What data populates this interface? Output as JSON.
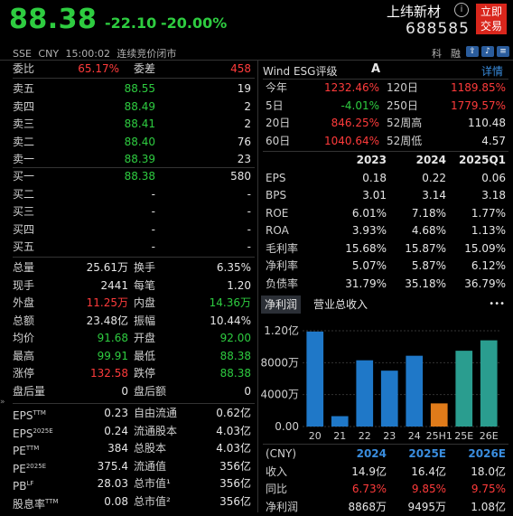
{
  "header": {
    "price": "88.38",
    "change": "-22.10",
    "change_pct": "-20.00%",
    "name": "上纬新材",
    "code": "688585",
    "info_icon": "i",
    "trade_button": [
      "立即",
      "交易"
    ],
    "sub": "SSE  CNY  15:00:02  连续竞价闭市",
    "right_tabs": [
      "科",
      "融"
    ]
  },
  "orderbook": {
    "wei_bi_label": "委比",
    "wei_bi": "65.17%",
    "wei_cha_label": "委差",
    "wei_cha": "458",
    "asks": [
      {
        "label": "卖五",
        "price": "88.55",
        "vol": "19"
      },
      {
        "label": "卖四",
        "price": "88.49",
        "vol": "2"
      },
      {
        "label": "卖三",
        "price": "88.41",
        "vol": "2"
      },
      {
        "label": "卖二",
        "price": "88.40",
        "vol": "76"
      },
      {
        "label": "卖一",
        "price": "88.39",
        "vol": "23"
      }
    ],
    "bids": [
      {
        "label": "买一",
        "price": "88.38",
        "vol": "580"
      },
      {
        "label": "买二",
        "price": "-",
        "vol": "-"
      },
      {
        "label": "买三",
        "price": "-",
        "vol": "-"
      },
      {
        "label": "买四",
        "price": "-",
        "vol": "-"
      },
      {
        "label": "买五",
        "price": "-",
        "vol": "-"
      }
    ]
  },
  "stats": [
    {
      "l1": "总量",
      "v1": "25.61万",
      "c1": "w",
      "l2": "换手",
      "v2": "6.35%",
      "c2": "w"
    },
    {
      "l1": "现手",
      "v1": "2441",
      "c1": "w",
      "l2": "每笔",
      "v2": "1.20",
      "c2": "w"
    },
    {
      "l1": "外盘",
      "v1": "11.25万",
      "c1": "r",
      "l2": "内盘",
      "v2": "14.36万",
      "c2": "g"
    },
    {
      "l1": "总额",
      "v1": "23.48亿",
      "c1": "w",
      "l2": "振幅",
      "v2": "10.44%",
      "c2": "w"
    },
    {
      "l1": "均价",
      "v1": "91.68",
      "c1": "g",
      "l2": "开盘",
      "v2": "92.00",
      "c2": "g"
    },
    {
      "l1": "最高",
      "v1": "99.91",
      "c1": "g",
      "l2": "最低",
      "v2": "88.38",
      "c2": "g"
    },
    {
      "l1": "涨停",
      "v1": "132.58",
      "c1": "r",
      "l2": "跌停",
      "v2": "88.38",
      "c2": "g"
    },
    {
      "l1": "盘后量",
      "v1": "0",
      "c1": "w",
      "l2": "盘后额",
      "v2": "0",
      "c2": "w"
    }
  ],
  "valuation": [
    {
      "l1": "EPS",
      "s1": "TTM",
      "v1": "0.23",
      "l2": "自由流通",
      "v2": "0.62亿"
    },
    {
      "l1": "EPS",
      "s1": "2025E",
      "v1": "0.24",
      "l2": "流通股本",
      "v2": "4.03亿"
    },
    {
      "l1": "PE",
      "s1": "TTM",
      "v1": "384",
      "l2": "总股本",
      "v2": "4.03亿"
    },
    {
      "l1": "PE",
      "s1": "2025E",
      "v1": "375.4",
      "l2": "流通值",
      "v2": "356亿"
    },
    {
      "l1": "PB",
      "s1": "LF",
      "v1": "28.03",
      "l2": "总市值¹",
      "v2": "356亿"
    },
    {
      "l1": "股息率",
      "s1": "TTM",
      "v1": "0.08",
      "l2": "总市值²",
      "v2": "356亿"
    }
  ],
  "esg": {
    "label": "Wind ESG评级",
    "grade": "A",
    "detail": "详情"
  },
  "returns": [
    {
      "l1": "今年",
      "v1": "1232.46%",
      "l2": "120日",
      "v2": "1189.85%",
      "c1": "r",
      "c2": "r"
    },
    {
      "l1": "5日",
      "v1": "-4.01%",
      "l2": "250日",
      "v2": "1779.57%",
      "c1": "g",
      "c2": "r"
    },
    {
      "l1": "20日",
      "v1": "846.25%",
      "l2": "52周高",
      "v2": "110.48",
      "c1": "r",
      "c2": "w"
    },
    {
      "l1": "60日",
      "v1": "1040.64%",
      "l2": "52周低",
      "v2": "4.57",
      "c1": "r",
      "c2": "w"
    }
  ],
  "fin": {
    "years": [
      "2023",
      "2024",
      "2025Q1"
    ],
    "rows": [
      {
        "label": "EPS",
        "vals": [
          "0.18",
          "0.22",
          "0.06"
        ]
      },
      {
        "label": "BPS",
        "vals": [
          "3.01",
          "3.14",
          "3.18"
        ]
      },
      {
        "label": "ROE",
        "vals": [
          "6.01%",
          "7.18%",
          "1.77%"
        ]
      },
      {
        "label": "ROA",
        "vals": [
          "3.93%",
          "4.68%",
          "1.13%"
        ]
      },
      {
        "label": "毛利率",
        "vals": [
          "15.68%",
          "15.87%",
          "15.09%"
        ]
      },
      {
        "label": "净利率",
        "vals": [
          "5.07%",
          "5.87%",
          "6.12%"
        ]
      },
      {
        "label": "负债率",
        "vals": [
          "31.79%",
          "35.18%",
          "36.79%"
        ]
      }
    ]
  },
  "chart_tabs": {
    "active": "净利润",
    "other": "营业总收入",
    "more": "•••"
  },
  "chart_data": {
    "type": "bar",
    "categories": [
      "20",
      "21",
      "22",
      "23",
      "24",
      "25H1",
      "25E",
      "26E"
    ],
    "values": [
      11900,
      1300,
      8300,
      7000,
      8868,
      2900,
      9495,
      10800
    ],
    "ylim": [
      0,
      12000
    ],
    "yticks": [
      "1.20亿",
      "8000万",
      "4000万",
      "0.00"
    ],
    "colors": [
      "#1f78c8",
      "#1f78c8",
      "#1f78c8",
      "#1f78c8",
      "#1f78c8",
      "#e07b1a",
      "#2a9d8f",
      "#2a9d8f"
    ]
  },
  "forecast": {
    "unit": "(CNY)",
    "years": [
      "2024",
      "2025E",
      "2026E"
    ],
    "rows": [
      {
        "label": "收入",
        "vals": [
          "14.9亿",
          "16.4亿",
          "18.0亿"
        ],
        "color": "w"
      },
      {
        "label": "同比",
        "vals": [
          "6.73%",
          "9.85%",
          "9.75%"
        ],
        "color": "r"
      },
      {
        "label": "净利润",
        "vals": [
          "8868万",
          "9495万",
          "1.08亿"
        ],
        "color": "w"
      }
    ]
  }
}
